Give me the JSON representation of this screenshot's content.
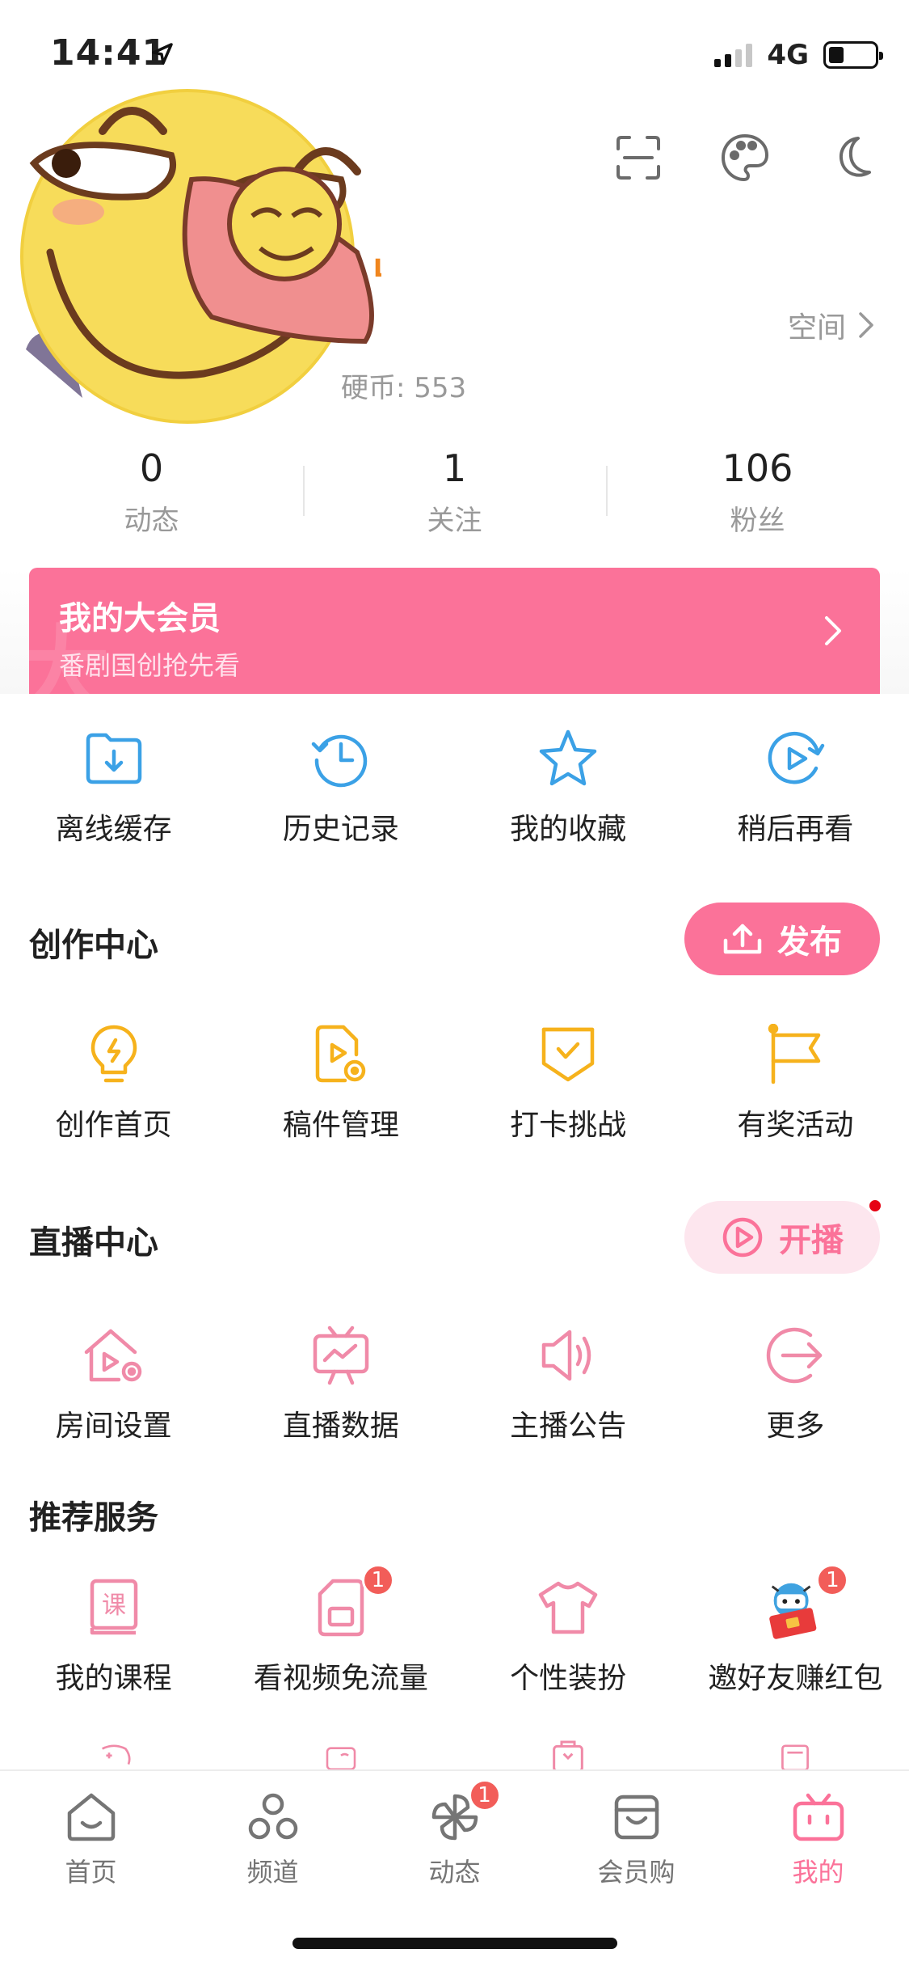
{
  "status_bar": {
    "time": "14:41",
    "network": "4G"
  },
  "profile": {
    "level": "LV5",
    "coins_label": "硬币: 553",
    "space_label": "空间"
  },
  "stats": [
    {
      "value": "0",
      "label": "动态"
    },
    {
      "value": "1",
      "label": "关注"
    },
    {
      "value": "106",
      "label": "粉丝"
    }
  ],
  "vip": {
    "title": "我的大会员",
    "subtitle": "番剧国创抢先看"
  },
  "quick_actions": [
    {
      "label": "离线缓存",
      "icon": "offline-cache-icon"
    },
    {
      "label": "历史记录",
      "icon": "history-icon"
    },
    {
      "label": "我的收藏",
      "icon": "favorites-icon"
    },
    {
      "label": "稍后再看",
      "icon": "watch-later-icon"
    }
  ],
  "creation_center": {
    "title": "创作中心",
    "publish_label": "发布",
    "items": [
      {
        "label": "创作首页",
        "icon": "lightbulb-icon"
      },
      {
        "label": "稿件管理",
        "icon": "manuscript-icon"
      },
      {
        "label": "打卡挑战",
        "icon": "check-badge-icon"
      },
      {
        "label": "有奖活动",
        "icon": "flag-icon"
      }
    ]
  },
  "live_center": {
    "title": "直播中心",
    "start_label": "开播",
    "items": [
      {
        "label": "房间设置",
        "icon": "room-settings-icon"
      },
      {
        "label": "直播数据",
        "icon": "live-data-icon"
      },
      {
        "label": "主播公告",
        "icon": "announcement-icon"
      },
      {
        "label": "更多",
        "icon": "more-arrow-icon"
      }
    ]
  },
  "recommended": {
    "title": "推荐服务",
    "items": [
      {
        "label": "我的课程",
        "icon": "course-icon",
        "badge": ""
      },
      {
        "label": "看视频免流量",
        "icon": "sim-card-icon",
        "badge": "1"
      },
      {
        "label": "个性装扮",
        "icon": "tshirt-icon",
        "badge": ""
      },
      {
        "label": "邀好友赚红包",
        "icon": "invite-mascot-icon",
        "badge": "1"
      }
    ]
  },
  "tabbar": [
    {
      "label": "首页",
      "icon": "home-icon",
      "badge": ""
    },
    {
      "label": "频道",
      "icon": "channel-icon",
      "badge": ""
    },
    {
      "label": "动态",
      "icon": "dynamic-pinwheel-icon",
      "badge": "1"
    },
    {
      "label": "会员购",
      "icon": "shopping-bag-icon",
      "badge": ""
    },
    {
      "label": "我的",
      "icon": "mine-tv-icon",
      "badge": ""
    }
  ],
  "colors": {
    "accent": "#fb7299",
    "blue": "#3ba1e6",
    "yellow": "#f6b21c",
    "text": "#212121",
    "muted": "#999999"
  }
}
